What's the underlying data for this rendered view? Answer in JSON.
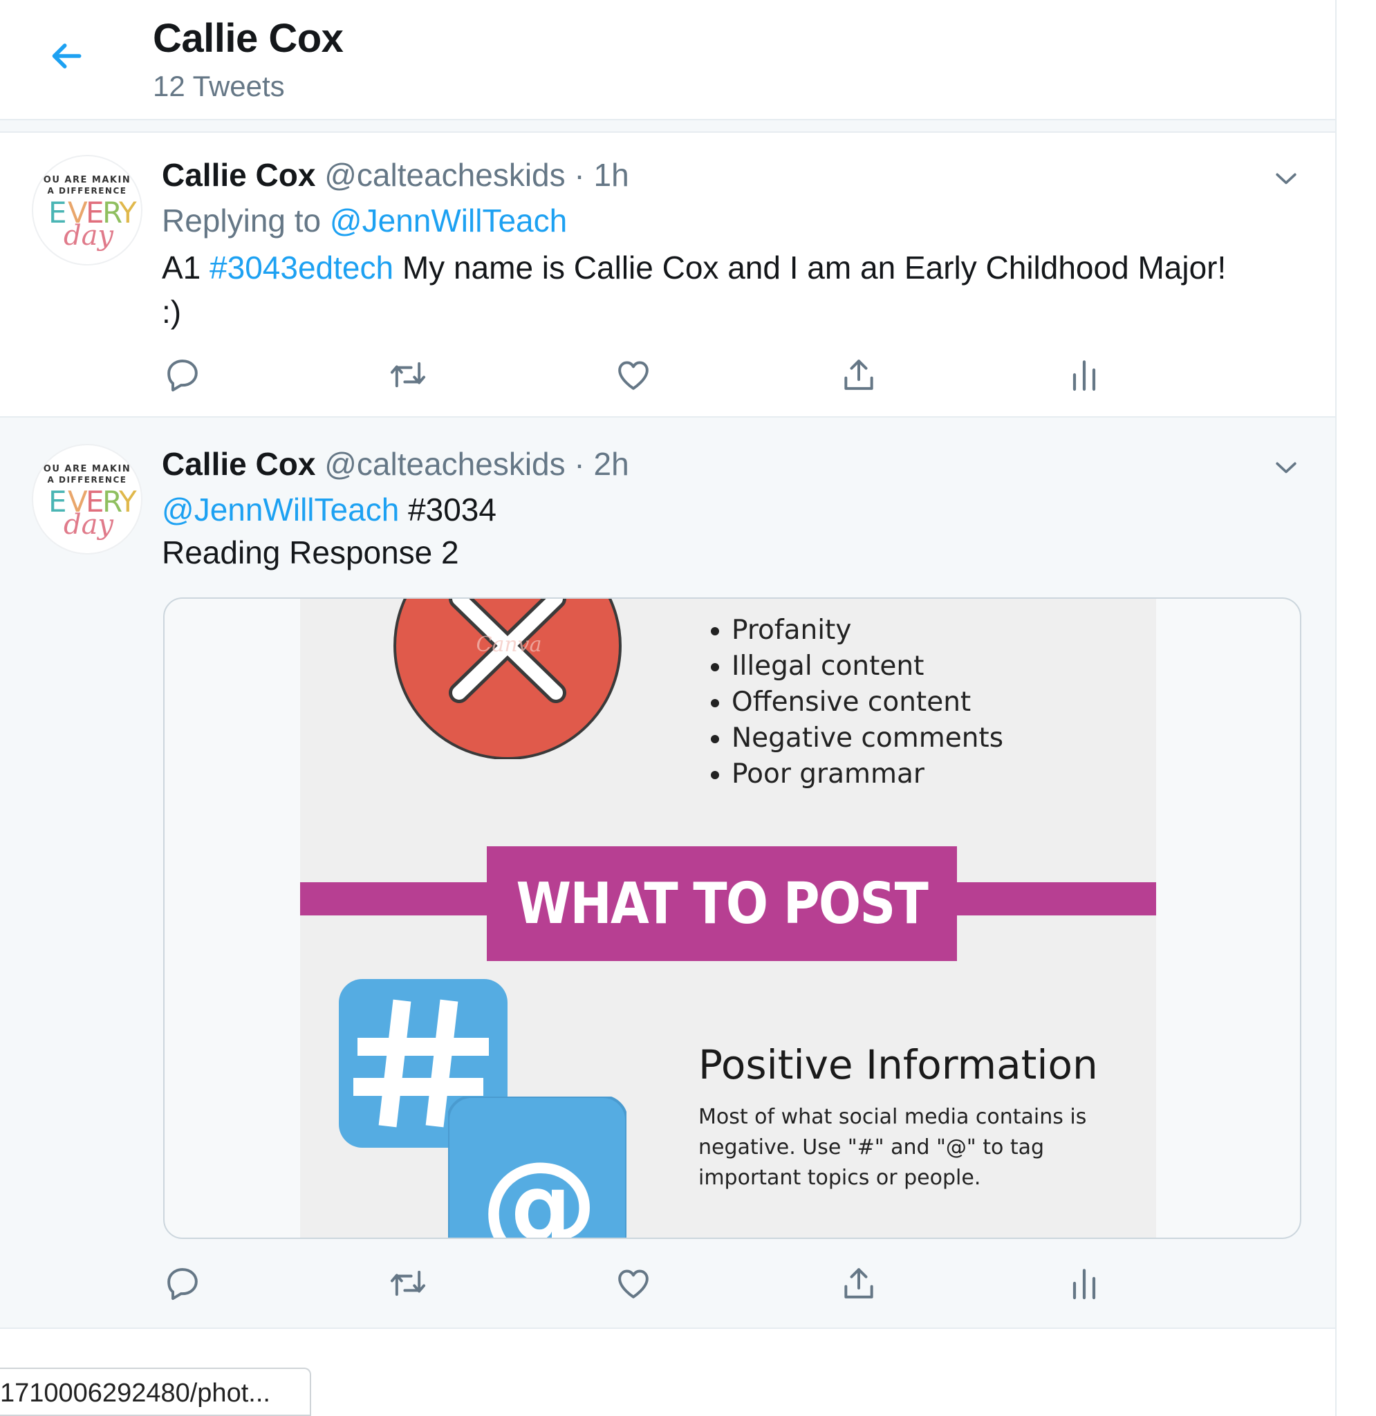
{
  "header": {
    "title": "Callie Cox",
    "subtitle": "12 Tweets"
  },
  "tweets": [
    {
      "name": "Callie Cox",
      "handle": "@calteacheskids",
      "separator": "·",
      "time": "1h",
      "replying_prefix": "Replying to",
      "replying_to": "@JennWillTeach",
      "text_prefix": "A1",
      "hashtag": "#3043edtech",
      "text_main": "My name is Callie Cox and I am an Early Childhood Major!",
      "text_continued": ":)"
    },
    {
      "name": "Callie Cox",
      "handle": "@calteacheskids",
      "separator": "·",
      "time": "2h",
      "mention": "@JennWillTeach",
      "tag_text": "#3034",
      "line2": "Reading Response 2",
      "media": {
        "bullets": [
          "Profanity",
          "Illegal content",
          "Offensive content",
          "Negative comments",
          "Poor grammar"
        ],
        "heading": "WHAT TO POST",
        "subtitle": "Positive Information",
        "body": "Most of what social media contains is negative. Use \"#\" and \"@\" to tag important topics or people.",
        "watermark": "Canva"
      }
    }
  ],
  "avatar": {
    "line1": "OU ARE MAKIN",
    "line2": "A DIFFERENCE",
    "word1": "EVERY",
    "word2": "day"
  },
  "status_bar": {
    "url": "1710006292480/phot..."
  },
  "icons": {
    "back": "arrow-left-icon",
    "caret": "chevron-down-icon",
    "reply": "reply-icon",
    "retweet": "retweet-icon",
    "like": "heart-icon",
    "share": "share-icon",
    "analytics": "analytics-icon"
  },
  "colors": {
    "accent": "#1da1f2",
    "muted": "#657786",
    "magenta": "#b73f92",
    "red": "#e05a4b",
    "tile_blue": "#55ace2"
  }
}
